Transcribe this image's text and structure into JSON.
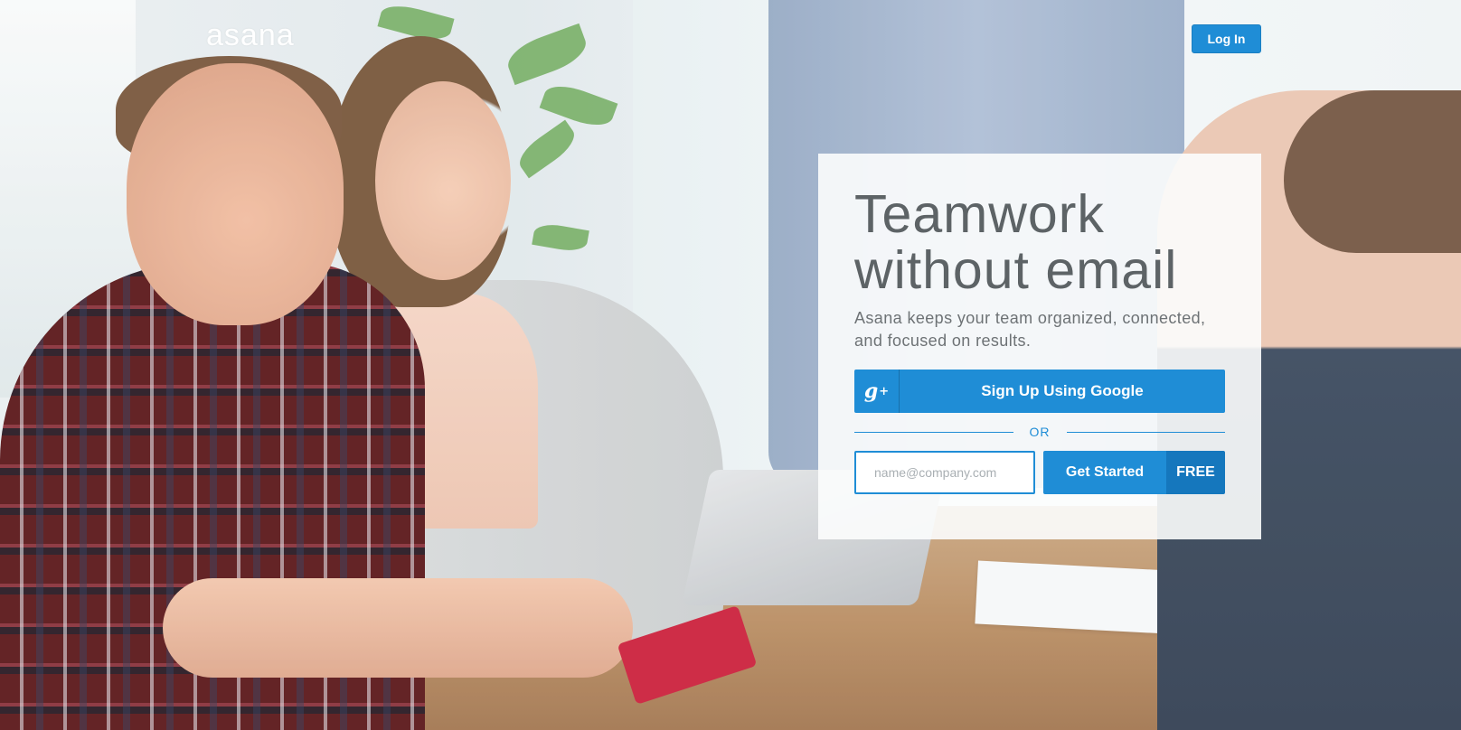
{
  "brand": {
    "logo_text": "asana",
    "accent_color": "#1f8dd6",
    "accent_dark": "#1577bd"
  },
  "header": {
    "login_label": "Log In"
  },
  "hero": {
    "headline_line1": "Teamwork",
    "headline_line2": "without email",
    "subhead": "Asana keeps your team organized, connected, and focused on results."
  },
  "signup": {
    "google_icon": "google-plus-icon",
    "google_icon_glyph": "g",
    "google_icon_sup": "+",
    "google_label": "Sign Up Using Google",
    "or_label": "OR",
    "email_placeholder": "name@company.com",
    "email_value": "",
    "get_started_label": "Get Started",
    "free_label": "FREE"
  }
}
